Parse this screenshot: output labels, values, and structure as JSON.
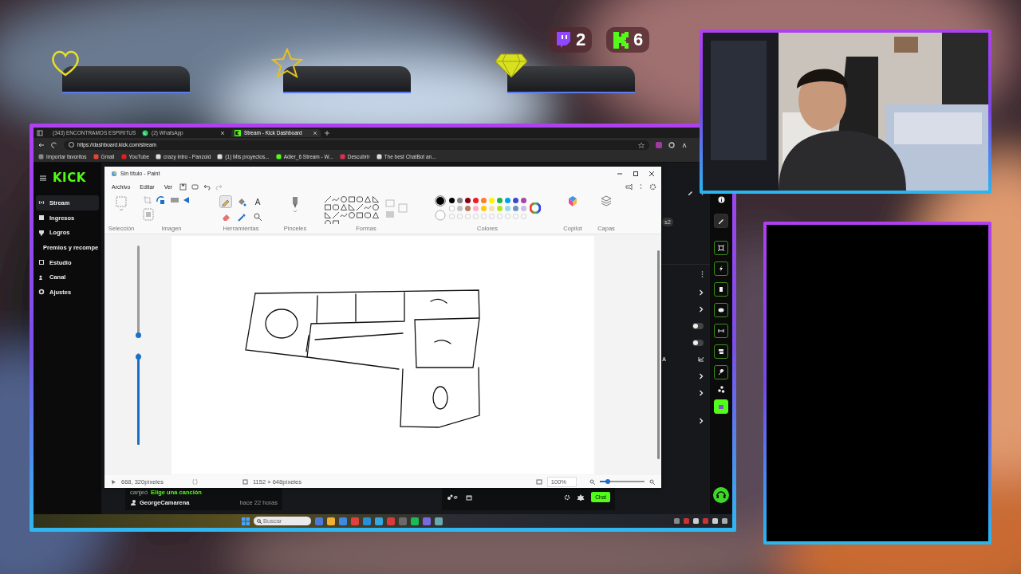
{
  "stream_goals": [
    {
      "kind": "heart"
    },
    {
      "kind": "star"
    },
    {
      "kind": "diamond"
    }
  ],
  "follower_counts": [
    {
      "kind": "twitch",
      "count": "2"
    },
    {
      "kind": "kick",
      "count": "6"
    }
  ],
  "browser": {
    "tabs": [
      {
        "label": "(343) ENCONTRAMOS ESPIRITUS",
        "kind": "video",
        "selected": false
      },
      {
        "label": "(2) WhatsApp",
        "kind": "chat",
        "selected": false
      },
      {
        "label": "Stream - Kick Dashboard",
        "kind": "kick",
        "selected": true
      }
    ],
    "url": "https://dashboard.kick.com/stream",
    "bookmarks": [
      "Importar favoritos",
      "Gmail",
      "YouTube",
      "crazy intro - Panzoid",
      "(1) Mis proyectos...",
      "Adler_6 Stream - W...",
      "Descubrir",
      "The best ChatBot an..."
    ]
  },
  "dashboard": {
    "logo": "KICK",
    "nav": [
      {
        "label": "Stream",
        "selected": true
      },
      {
        "label": "Ingresos",
        "selected": false
      },
      {
        "label": "Logros",
        "selected": false
      },
      {
        "label": "Premios y recompe",
        "selected": false
      },
      {
        "label": "Estudio",
        "selected": false
      },
      {
        "label": "Canal",
        "selected": false
      },
      {
        "label": "Ajustes",
        "selected": false
      }
    ],
    "badge": "s2",
    "side_letter": "A",
    "settings": [
      {
        "kind": "chevron"
      },
      {
        "kind": "chevron"
      },
      {
        "kind": "toggle",
        "on": false
      },
      {
        "kind": "toggle",
        "on": false
      },
      {
        "kind": "chart"
      },
      {
        "kind": "chevron"
      },
      {
        "kind": "chevron"
      },
      {
        "kind": "chevron"
      }
    ],
    "activity": {
      "action": "canjeó",
      "reward": "Elige una canción",
      "user": "GeorgeCamarena",
      "time": "hace 22 horas"
    },
    "chat_button": "Chat"
  },
  "paint": {
    "title": "Sin título - Paint",
    "menu": [
      "Archivo",
      "Editar",
      "Ver"
    ],
    "groups": [
      "Selección",
      "Imagen",
      "Herramientas",
      "Pinceles",
      "Formas",
      "Colores",
      "Copilot",
      "Capas"
    ],
    "tools": [
      {
        "kind": "pencil",
        "selected": true
      },
      {
        "kind": "fill",
        "selected": false
      },
      {
        "kind": "text",
        "glyph": "A",
        "selected": false
      },
      {
        "kind": "eraser",
        "selected": false
      },
      {
        "kind": "picker",
        "selected": false
      },
      {
        "kind": "magnifier",
        "selected": false
      }
    ],
    "palette": [
      {
        "color": "#000000"
      },
      {
        "color": "#7f7f7f"
      },
      {
        "color": "#880015"
      },
      {
        "color": "#ed1c24"
      },
      {
        "color": "#ff7f27"
      },
      {
        "color": "#fff200"
      },
      {
        "color": "#22b14c"
      },
      {
        "color": "#00a2e8"
      },
      {
        "color": "#3f48cc"
      },
      {
        "color": "#a349a4"
      },
      {
        "color": "#ffffff"
      },
      {
        "color": "#c3c3c3"
      },
      {
        "color": "#b97a57"
      },
      {
        "color": "#ffaec9"
      },
      {
        "color": "#ffc90e"
      },
      {
        "color": "#efe4b0"
      },
      {
        "color": "#b5e61d"
      },
      {
        "color": "#99d9ea"
      },
      {
        "color": "#7092be"
      },
      {
        "color": "#c8bfe7"
      }
    ],
    "size_sliders": [
      {
        "level": 0.02
      },
      {
        "level": 0.96
      }
    ],
    "cursor_position": "668, 320píxeles",
    "canvas_size": "1152 × 648píxeles",
    "zoom": "100%",
    "zoom_slider": {
      "level": 0.17
    }
  },
  "taskbar": {
    "search_placeholder": "Buscar"
  }
}
